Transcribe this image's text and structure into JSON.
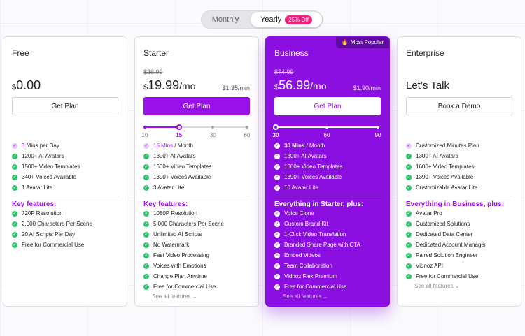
{
  "toggle": {
    "monthly": "Monthly",
    "yearly": "Yearly",
    "discount": "25% Off"
  },
  "colors": {
    "accent": "#9a10ec",
    "business_bg": "#8a0fe0",
    "check": "#2fc36a",
    "badge": "#f0207a"
  },
  "plans": {
    "free": {
      "name": "Free",
      "currency": "$",
      "price": "0.00",
      "button": "Get Plan",
      "features": [
        {
          "hl": "3",
          "text": " Mins per Day"
        },
        {
          "hl": "",
          "text": "1200+ AI Avatars"
        },
        {
          "hl": "",
          "text": "1500+ Video Templates"
        },
        {
          "hl": "",
          "text": "340+ Voices Available"
        },
        {
          "hl": "",
          "text": "1 Avatar Lite"
        }
      ],
      "key_title": "Key features:",
      "key_features": [
        "720P Resolution",
        "2,000 Characters Per Scene",
        "20 AI Scripts Per Day",
        "Free for Commercial Use"
      ]
    },
    "starter": {
      "name": "Starter",
      "old_price": "$26.99",
      "currency": "$",
      "price": "19.99",
      "per": "/mo",
      "per_min": "$1.35/min",
      "button": "Get Plan",
      "slider": {
        "labels": [
          "10",
          "15",
          "30",
          "60"
        ],
        "selected_index": 1
      },
      "features": [
        {
          "hl": "15 Mins",
          "text": " / Month"
        },
        {
          "hl": "",
          "text": "1300+ AI Avatars"
        },
        {
          "hl": "",
          "text": "1600+ Video Templates"
        },
        {
          "hl": "",
          "text": "1390+ Voices Available"
        },
        {
          "hl": "",
          "text": "3 Avatar Lite"
        }
      ],
      "key_title": "Key features:",
      "key_features": [
        "1080P Resolution",
        "5,000 Characters Per Scene",
        "Unlimited AI Scripts",
        "No Watermark",
        "Fast Video Processing",
        "Voices with Emotions",
        "Change Plan Anytime",
        "Free for Commercial Use"
      ],
      "see_all": "See all features"
    },
    "business": {
      "name": "Business",
      "popular": "Most Popular",
      "popular_icon": "fire-icon",
      "old_price": "$74.99",
      "currency": "$",
      "price": "56.99",
      "per": "/mo",
      "per_min": "$1.90/min",
      "button": "Get Plan",
      "slider": {
        "labels": [
          "30",
          "60",
          "90"
        ],
        "selected_index": 0
      },
      "features": [
        {
          "hl": "30 Mins",
          "text": " / Month"
        },
        {
          "hl": "",
          "text": "1300+ AI Avatars"
        },
        {
          "hl": "",
          "text": "1600+ Video Templates"
        },
        {
          "hl": "",
          "text": "1390+ Voices Available"
        },
        {
          "hl": "",
          "text": "10 Avatar Lite"
        }
      ],
      "key_title": "Everything in Starter, plus:",
      "key_features": [
        "Voice Clone",
        "Custom Brand Kit",
        "1-Click Video Translation",
        "Branded Share Page with CTA",
        "Embed Videos",
        "Team Collaboration",
        "Vidnoz Flex Premium",
        "Free for Commercial Use"
      ],
      "see_all": "See all features"
    },
    "enterprise": {
      "name": "Enterprise",
      "headline": "Let’s Talk",
      "button": "Book a Demo",
      "features": [
        {
          "hl": "",
          "text": "Customized Minutes Plan"
        },
        {
          "hl": "",
          "text": "1300+ AI Avatars"
        },
        {
          "hl": "",
          "text": "1600+ Video Templates"
        },
        {
          "hl": "",
          "text": "1390+ Voices Available"
        },
        {
          "hl": "",
          "text": "Customizable Avatar Lite"
        }
      ],
      "key_title": "Everything in Business, plus:",
      "key_features": [
        "Avatar Pro",
        "Customized Solutions",
        "Dedicated Data Center",
        "Dedicated Account Manager",
        "Paired Solution Engineer",
        "Vidnoz API",
        "Free for Commercial Use"
      ],
      "see_all": "See all features"
    }
  }
}
